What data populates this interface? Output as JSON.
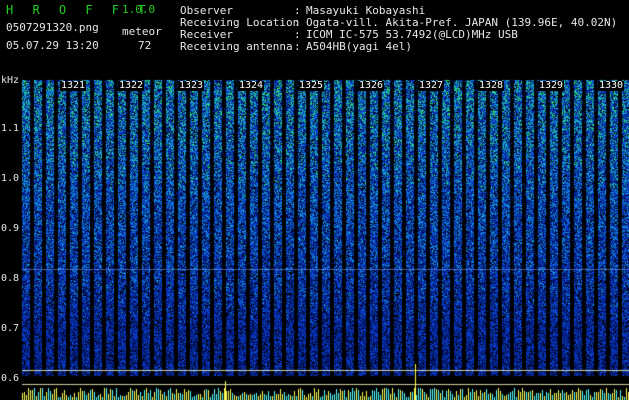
{
  "app": {
    "title": "H R O F F T",
    "version": "1.0.0"
  },
  "file": {
    "name": "0507291320.png",
    "datetime": "05.07.29 13:20"
  },
  "meteor": {
    "label": "meteor",
    "count": "72"
  },
  "info": [
    {
      "label": "Observer",
      "sep": ":",
      "value": "Masayuki Kobayashi"
    },
    {
      "label": "Receiving Location",
      "sep": ":",
      "value": "Ogata-vill. Akita-Pref. JAPAN (139.96E, 40.02N)"
    },
    {
      "label": "Receiver",
      "sep": ":",
      "value": "ICOM IC-575 53.7492(@LCD)MHz USB"
    },
    {
      "label": "Receiving antenna",
      "sep": ":",
      "value": "A504HB(yagi 4el)"
    }
  ],
  "axis": {
    "unit": "kHz",
    "y_ticks": [
      "1.1",
      "1.0",
      "0.9",
      "0.8",
      "0.7",
      "0.6"
    ],
    "minute_labels": [
      "1321",
      "1322",
      "1323",
      "1324",
      "1325",
      "1326",
      "1327",
      "1328",
      "1329",
      "1330"
    ]
  },
  "colors": {
    "green": "#22cc22",
    "yellow": "#ffff55",
    "text": "#e6e6e6"
  }
}
